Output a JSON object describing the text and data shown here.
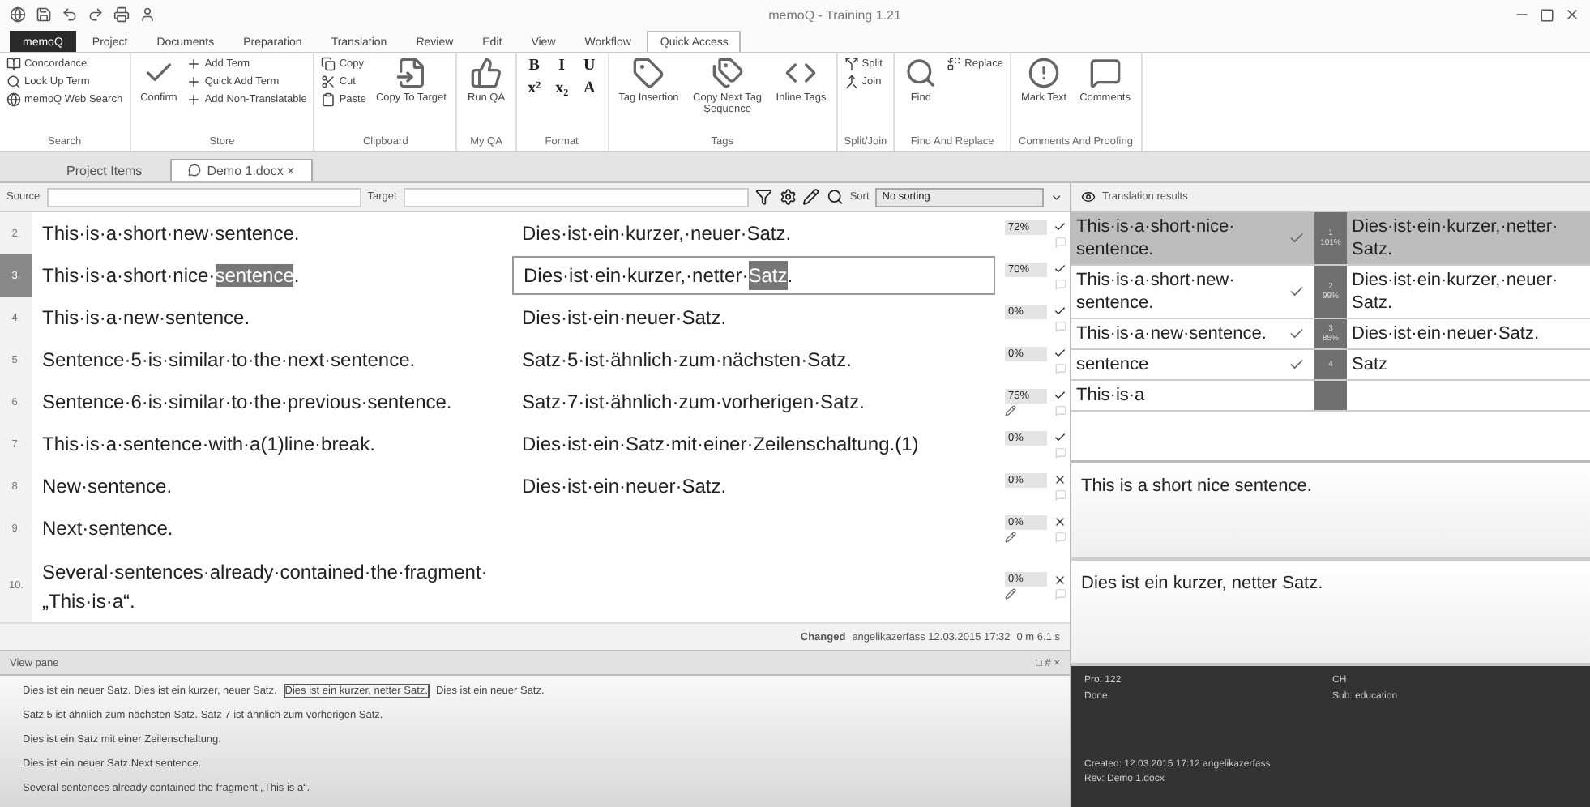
{
  "window": {
    "title": "memoQ - Training 1.21"
  },
  "ribbon_tabs": [
    {
      "label": "memoQ",
      "selected": false,
      "kind": "app"
    },
    {
      "label": "Project",
      "selected": false,
      "kind": "tab"
    },
    {
      "label": "Documents",
      "selected": false,
      "kind": "tab"
    },
    {
      "label": "Preparation",
      "selected": false,
      "kind": "tab"
    },
    {
      "label": "Translation",
      "selected": false,
      "kind": "tab"
    },
    {
      "label": "Review",
      "selected": false,
      "kind": "tab"
    },
    {
      "label": "Edit",
      "selected": false,
      "kind": "tab"
    },
    {
      "label": "View",
      "selected": false,
      "kind": "tab"
    },
    {
      "label": "Workflow",
      "selected": false,
      "kind": "tab"
    },
    {
      "label": "Quick Access",
      "selected": true,
      "kind": "tab"
    }
  ],
  "ribbon_groups": [
    {
      "label": "Search",
      "items": [
        {
          "label": "Concordance",
          "kind": "small"
        },
        {
          "label": "Look Up Term",
          "kind": "small"
        },
        {
          "label": "memoQ Web Search",
          "kind": "small"
        }
      ]
    },
    {
      "label": "Store",
      "items": [
        {
          "label": "Confirm",
          "kind": "large"
        },
        {
          "label": "Add Term",
          "kind": "small"
        },
        {
          "label": "Quick Add Term",
          "kind": "small"
        },
        {
          "label": "Add Non-Translatable",
          "kind": "small"
        }
      ]
    },
    {
      "label": "Clipboard",
      "items": [
        {
          "label": "Copy",
          "kind": "small"
        },
        {
          "label": "Cut",
          "kind": "small"
        },
        {
          "label": "Paste",
          "kind": "small"
        },
        {
          "label": "Copy To Target",
          "kind": "large"
        }
      ]
    },
    {
      "label": "My QA",
      "items": [
        {
          "label": "Run QA",
          "kind": "large"
        }
      ]
    },
    {
      "label": "Format",
      "items": [
        {
          "label": "B",
          "kind": "format"
        },
        {
          "label": "I",
          "kind": "format"
        },
        {
          "label": "U",
          "kind": "format"
        },
        {
          "label": "x²",
          "kind": "format"
        },
        {
          "label": "x₂",
          "kind": "format"
        },
        {
          "label": "A",
          "kind": "format"
        }
      ]
    },
    {
      "label": "Tags",
      "items": [
        {
          "label": "Tag Insertion",
          "kind": "large"
        },
        {
          "label": "Copy Next Tag Sequence",
          "kind": "large"
        },
        {
          "label": "Inline Tags",
          "kind": "large"
        }
      ]
    },
    {
      "label": "Split/Join",
      "items": [
        {
          "label": "Split",
          "kind": "small"
        },
        {
          "label": "Join",
          "kind": "small"
        }
      ]
    },
    {
      "label": "Find And Replace",
      "items": [
        {
          "label": "Find",
          "kind": "large"
        },
        {
          "label": "Replace",
          "kind": "small"
        }
      ]
    },
    {
      "label": "Comments And Proofing",
      "items": [
        {
          "label": "Mark Text",
          "kind": "large"
        },
        {
          "label": "Comments",
          "kind": "large"
        }
      ]
    }
  ],
  "doc_tabs": [
    {
      "label": "Project Items",
      "selected": false
    },
    {
      "label": "Demo 1.docx",
      "selected": true,
      "close": "×"
    }
  ],
  "filter_bar": {
    "source_label": "Source",
    "target_label": "Target",
    "sort_label": "Sort",
    "sort_value": "No sorting"
  },
  "rows": [
    {
      "number": "2.",
      "source": [
        {
          "text": "This·is·a·short·new·sentence.",
          "hit": false
        }
      ],
      "target": [
        {
          "text": "Dies·ist·ein·kurzer,·neuer·Satz.",
          "hit": false
        }
      ],
      "match": "72%",
      "confirmed": true,
      "edited": false,
      "selected": false
    },
    {
      "number": "3.",
      "source": [
        {
          "text": "This·is·a·short·nice·",
          "hit": false
        },
        {
          "text": "sentence",
          "hit": true
        },
        {
          "text": ".",
          "hit": false
        }
      ],
      "target": [
        {
          "text": "Dies·ist·ein·kurzer,·netter·",
          "hit": false
        },
        {
          "text": "Satz",
          "hit": true
        },
        {
          "text": ".",
          "hit": false
        }
      ],
      "match": "70%",
      "confirmed": true,
      "edited": false,
      "selected": true
    },
    {
      "number": "4.",
      "source": [
        {
          "text": "This·is·a·new·sentence.",
          "hit": false
        }
      ],
      "target": [
        {
          "text": "Dies·ist·ein·neuer·Satz.",
          "hit": false
        }
      ],
      "match": "0%",
      "confirmed": true,
      "edited": false,
      "selected": false
    },
    {
      "number": "5.",
      "source": [
        {
          "text": "Sentence·5·is·similar·to·the·next·sentence.",
          "hit": false
        }
      ],
      "target": [
        {
          "text": "Satz·5·ist·ähnlich·zum·nächsten·Satz.",
          "hit": false
        }
      ],
      "match": "0%",
      "confirmed": true,
      "edited": false,
      "selected": false
    },
    {
      "number": "6.",
      "source": [
        {
          "text": "Sentence·6·is·similar·to·the·previous·sentence.",
          "hit": false
        }
      ],
      "target": [
        {
          "text": "Satz·7·ist·ähnlich·zum·vorherigen·Satz.",
          "hit": false
        }
      ],
      "match": "75%",
      "confirmed": true,
      "edited": true,
      "selected": false
    },
    {
      "number": "7.",
      "source": [
        {
          "text": "This·is·a·sentence·with·a(1)line·break.",
          "hit": false
        }
      ],
      "target": [
        {
          "text": "Dies·ist·ein·Satz·mit·einer·Zeilenschaltung.(1)",
          "hit": false
        }
      ],
      "match": "0%",
      "confirmed": true,
      "edited": false,
      "selected": false
    },
    {
      "number": "8.",
      "source": [
        {
          "text": "New·sentence.",
          "hit": false
        }
      ],
      "target": [
        {
          "text": "Dies·ist·ein·neuer·Satz.",
          "hit": false
        }
      ],
      "match": "0%",
      "confirmed": false,
      "edited": false,
      "selected": false
    },
    {
      "number": "9.",
      "source": [
        {
          "text": "Next·sentence.",
          "hit": false
        }
      ],
      "target": [],
      "match": "0%",
      "confirmed": false,
      "edited": true,
      "selected": false
    },
    {
      "number": "10.",
      "source": [
        {
          "text": "Several·sentences·already·contained·the·fragment· „This·is·a“.",
          "hit": false
        }
      ],
      "target": [],
      "match": "0%",
      "confirmed": false,
      "edited": true,
      "selected": false
    }
  ],
  "status_bar": {
    "changed_label": "Changed",
    "changed_value": "angelikazerfass 12.03.2015 17:32",
    "timer": "0 m 6.1 s"
  },
  "view_pane": {
    "title": "View pane",
    "controls": "□ # ×",
    "lines": [
      [
        {
          "text": "Dies ist ein neuer Satz. Dies ist ein kurzer, neuer Satz.",
          "boxed": false
        },
        {
          "text": "Dies ist ein kurzer, netter Satz.",
          "boxed": true
        },
        {
          "text": "Dies ist ein neuer Satz.",
          "boxed": false
        }
      ],
      [
        {
          "text": "Satz 5 ist ähnlich zum nächsten Satz. Satz 7 ist ähnlich zum vorherigen Satz.",
          "boxed": false
        }
      ],
      [
        {
          "text": "Dies ist ein Satz mit einer Zeilenschaltung.",
          "boxed": false
        }
      ],
      [
        {
          "text": "Dies ist ein neuer Satz.Next sentence.",
          "boxed": false
        }
      ],
      [
        {
          "text": "Several sentences already contained the fragment „This is a“.",
          "boxed": false
        }
      ]
    ]
  },
  "translation_results": {
    "title": "Translation results",
    "rows": [
      {
        "source": "This·is·a·short·nice· sentence.",
        "target": "Dies·ist·ein·kurzer,·netter· Satz.",
        "number": "1",
        "score": "101%",
        "selected": true
      },
      {
        "source": "This·is·a·short·new· sentence.",
        "target": "Dies·ist·ein·kurzer,·neuer· Satz.",
        "number": "2",
        "score": "99%",
        "selected": false
      },
      {
        "source": "This·is·a·new·sentence.",
        "target": "Dies·ist·ein·neuer·Satz.",
        "number": "3",
        "score": "85%",
        "selected": false
      },
      {
        "source": "sentence",
        "target": "Satz",
        "number": "4",
        "score": "",
        "selected": false
      },
      {
        "source": "This·is·a",
        "target": "",
        "number": "",
        "score": "",
        "selected": false
      }
    ]
  },
  "source_preview": "This is a short nice sentence.",
  "target_preview": "Dies ist ein kurzer, netter Satz.",
  "info_panel": {
    "left": [
      "Pro: 122",
      "Done"
    ],
    "right": [
      "CH",
      "Sub: education"
    ],
    "footer": [
      "Created: 12.03.2015 17:12 angelikazerfass",
      "Rev: Demo 1.docx"
    ]
  }
}
